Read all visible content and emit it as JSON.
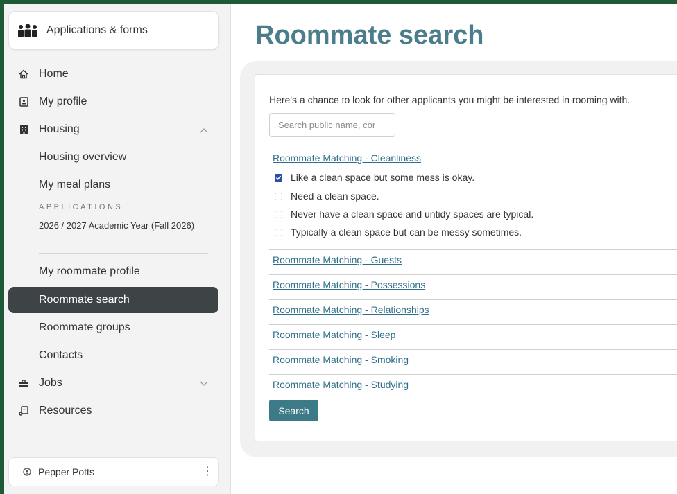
{
  "app_card": {
    "label": "Applications & forms",
    "icon": "people-group-icon"
  },
  "nav": {
    "home": "Home",
    "profile": "My profile",
    "housing": "Housing",
    "housing_sub": {
      "overview": "Housing overview",
      "meal_plans": "My meal plans",
      "applications_label": "APPLICATIONS",
      "app_year": "2026 / 2027 Academic Year (Fall 2026)",
      "roommate_profile": "My roommate profile",
      "roommate_search": "Roommate search",
      "roommate_groups": "Roommate groups",
      "contacts": "Contacts"
    },
    "jobs": "Jobs",
    "resources": "Resources"
  },
  "user": {
    "name": "Pepper Potts"
  },
  "main": {
    "title": "Roommate search",
    "intro": "Here's a chance to look for other applicants you might be interested in rooming with.",
    "search_placeholder": "Search public name, cor",
    "filters": [
      "Roommate Matching - Cleanliness",
      "Roommate Matching - Guests",
      "Roommate Matching - Possessions",
      "Roommate Matching - Relationships",
      "Roommate Matching - Sleep",
      "Roommate Matching - Smoking",
      "Roommate Matching - Studying"
    ],
    "cleanliness_options": [
      {
        "label": "Like a clean space but some mess is okay.",
        "checked": true
      },
      {
        "label": "Need a clean space.",
        "checked": false
      },
      {
        "label": "Never have a clean space and untidy spaces are typical.",
        "checked": false
      },
      {
        "label": "Typically a clean space but can be messy sometimes.",
        "checked": false
      }
    ],
    "search_button": "Search"
  },
  "colors": {
    "accent": "#3d7a87",
    "title": "#4b7d8d",
    "link": "#2f6f8b",
    "active_nav": "#3e4346",
    "border_frame": "#1f5a36"
  }
}
